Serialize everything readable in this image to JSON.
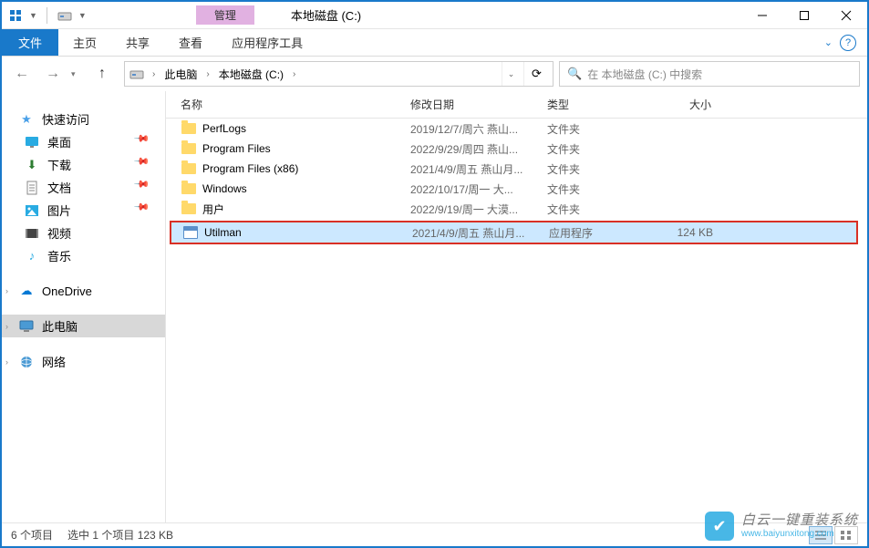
{
  "titlebar": {
    "context_tab_group": "管理",
    "window_title": "本地磁盘 (C:)"
  },
  "ribbon": {
    "file": "文件",
    "home": "主页",
    "share": "共享",
    "view": "查看",
    "contextual": "应用程序工具"
  },
  "breadcrumb": {
    "root": "此电脑",
    "drive": "本地磁盘 (C:)"
  },
  "search": {
    "placeholder": "在 本地磁盘 (C:) 中搜索"
  },
  "nav_pane": {
    "quick_access": "快速访问",
    "desktop": "桌面",
    "downloads": "下载",
    "documents": "文档",
    "pictures": "图片",
    "videos": "视频",
    "music": "音乐",
    "onedrive": "OneDrive",
    "this_pc": "此电脑",
    "network": "网络"
  },
  "columns": {
    "name": "名称",
    "date": "修改日期",
    "type": "类型",
    "size": "大小"
  },
  "files": [
    {
      "name": "PerfLogs",
      "date": "2019/12/7/周六 燕山...",
      "type": "文件夹",
      "size": ""
    },
    {
      "name": "Program Files",
      "date": "2022/9/29/周四 燕山...",
      "type": "文件夹",
      "size": ""
    },
    {
      "name": "Program Files (x86)",
      "date": "2021/4/9/周五 燕山月...",
      "type": "文件夹",
      "size": ""
    },
    {
      "name": "Windows",
      "date": "2022/10/17/周一 大...",
      "type": "文件夹",
      "size": ""
    },
    {
      "name": "用户",
      "date": "2022/9/19/周一 大漠...",
      "type": "文件夹",
      "size": ""
    }
  ],
  "highlighted_file": {
    "name": "Utilman",
    "date": "2021/4/9/周五 燕山月...",
    "type": "应用程序",
    "size": "124 KB"
  },
  "statusbar": {
    "items": "6 个项目",
    "selection": "选中 1 个项目  123 KB"
  },
  "watermark": {
    "line1": "白云一键重装系统",
    "line2": "www.baiyunxitong.com"
  }
}
